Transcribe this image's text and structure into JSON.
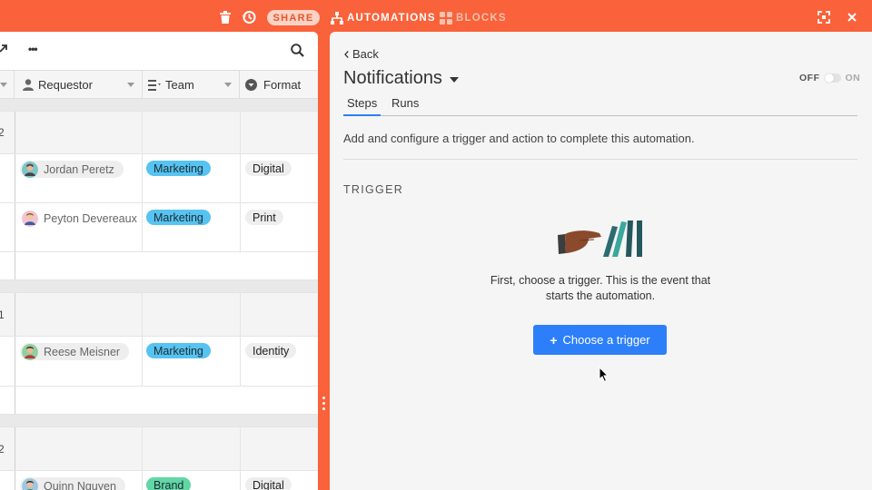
{
  "topbar": {
    "share_label": "SHARE",
    "automations_label": "AUTOMATIONS",
    "blocks_label": "BLOCKS",
    "icons": [
      "trash-icon",
      "history-icon",
      "automations-icon",
      "blocks-icon",
      "fullscreen-icon",
      "close-icon"
    ]
  },
  "grid": {
    "toolbar": {
      "more_label": "•••",
      "icons": [
        "expand-icon",
        "search-icon"
      ]
    },
    "columns": [
      {
        "label": "Requestor",
        "icon": "person-icon"
      },
      {
        "label": "Team",
        "icon": "list-icon"
      },
      {
        "label": "Format",
        "icon": "chevron-circle-icon"
      }
    ],
    "groups": [
      {
        "count": "2",
        "rows": [
          {
            "requestor": "Jordan Peretz",
            "team": "Marketing",
            "format": "Digital"
          },
          {
            "requestor": "Peyton Devereaux",
            "team": "Marketing",
            "format": "Print"
          }
        ]
      },
      {
        "count": "1",
        "rows": [
          {
            "requestor": "Reese Meisner",
            "team": "Marketing",
            "format": "Identity"
          }
        ]
      },
      {
        "count": "2",
        "rows": [
          {
            "requestor": "Quinn Nguyen",
            "team": "Brand",
            "format": "Digital"
          }
        ]
      }
    ],
    "team_colors": {
      "Marketing": "#56c3f0",
      "Brand": "#62d6a5"
    }
  },
  "automation": {
    "back_label": "Back",
    "title": "Notifications",
    "toggle": {
      "off_label": "OFF",
      "on_label": "ON",
      "state": "off"
    },
    "tabs": [
      {
        "label": "Steps",
        "active": true
      },
      {
        "label": "Runs",
        "active": false
      }
    ],
    "description": "Add and configure a trigger and action to complete this automation.",
    "section_label": "TRIGGER",
    "prompt_line1": "First, choose a trigger. This is the event that",
    "prompt_line2": "starts the automation.",
    "cta_label": "Choose a trigger",
    "accent_color": "#2d7ff9"
  },
  "colors": {
    "brand": "#f9623a",
    "panel_bg": "#f5f5f5"
  }
}
